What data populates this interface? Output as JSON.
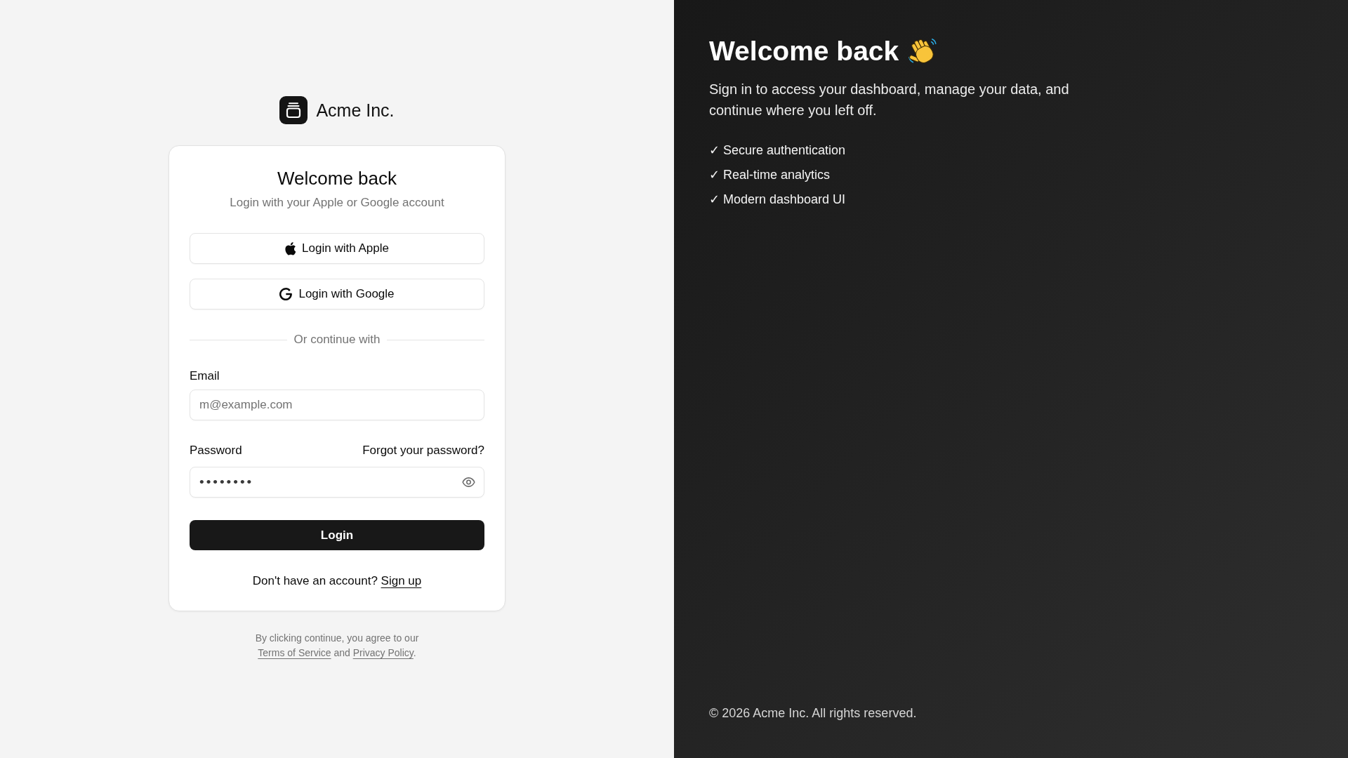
{
  "brand": {
    "name": "Acme Inc."
  },
  "login_card": {
    "title": "Welcome back",
    "subtitle": "Login with your Apple or Google account",
    "social_buttons": [
      {
        "kind": "apple",
        "label": "Login with Apple"
      },
      {
        "kind": "google",
        "label": "Login with Google"
      }
    ],
    "divider": "Or continue with",
    "email": {
      "label": "Email",
      "placeholder": "m@example.com"
    },
    "password": {
      "label": "Password",
      "forgot_link": "Forgot your password?",
      "value": "••••••••"
    },
    "submit_button": "Login",
    "signup": {
      "prompt": "Don't have an account?",
      "link": "Sign up"
    }
  },
  "legal": {
    "before": "By clicking continue, you agree to our",
    "terms_link": "Terms of Service",
    "between": "and",
    "privacy_link": "Privacy Policy",
    "after": "."
  },
  "hero": {
    "title": "Welcome back",
    "text": "Sign in to access your dashboard, manage your data, and continue where you left off.",
    "features": [
      "✓ Secure authentication",
      "✓ Real-time analytics",
      "✓ Modern dashboard UI"
    ],
    "copyright": "© 2026 Acme Inc. All rights reserved."
  }
}
